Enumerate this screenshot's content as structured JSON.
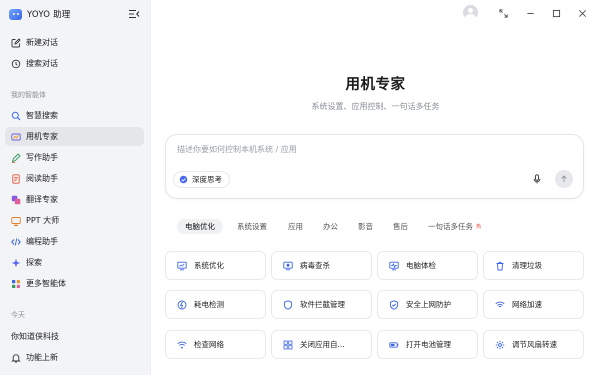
{
  "app": {
    "name": "YOYO 助理"
  },
  "sidebar": {
    "top_items": [
      {
        "label": "新建对话",
        "icon": "new-chat-icon"
      },
      {
        "label": "搜索对话",
        "icon": "history-search-icon"
      }
    ],
    "agents_section_label": "我的智能体",
    "agents": [
      {
        "label": "智慧搜索",
        "icon": "search-icon"
      },
      {
        "label": "用机专家",
        "icon": "device-expert-icon",
        "active": true
      },
      {
        "label": "写作助手",
        "icon": "pen-icon"
      },
      {
        "label": "阅读助手",
        "icon": "document-icon"
      },
      {
        "label": "翻译专家",
        "icon": "translate-icon"
      },
      {
        "label": "PPT 大师",
        "icon": "ppt-icon"
      },
      {
        "label": "编程助手",
        "icon": "code-icon"
      },
      {
        "label": "探索",
        "icon": "explore-icon"
      },
      {
        "label": "更多智能体",
        "icon": "more-icon"
      }
    ],
    "today_label": "今天",
    "history": [
      {
        "label": "你知道侠科技"
      },
      {
        "label": "功能上新",
        "icon": "bell-icon"
      }
    ]
  },
  "main": {
    "title": "用机专家",
    "subtitle": "系统设置、应用控制、一句话多任务",
    "composer": {
      "placeholder": "描述你要如何控制本机系统 / 应用",
      "value": "",
      "deep_think_label": "深度思考"
    },
    "tabs": [
      {
        "label": "电脑优化",
        "active": true
      },
      {
        "label": "系统设置"
      },
      {
        "label": "应用"
      },
      {
        "label": "办公"
      },
      {
        "label": "影音"
      },
      {
        "label": "售后"
      },
      {
        "label": "一句话多任务",
        "badge": "热"
      }
    ],
    "cards": [
      {
        "label": "系统优化",
        "icon": "monitor-optimize-icon"
      },
      {
        "label": "病毒查杀",
        "icon": "virus-scan-icon"
      },
      {
        "label": "电脑体检",
        "icon": "pc-checkup-icon"
      },
      {
        "label": "清理垃圾",
        "icon": "trash-icon"
      },
      {
        "label": "耗电检测",
        "icon": "battery-check-icon"
      },
      {
        "label": "软件拦截管理",
        "icon": "shield-icon"
      },
      {
        "label": "安全上网防护",
        "icon": "shield-check-icon"
      },
      {
        "label": "网络加速",
        "icon": "wifi-icon"
      },
      {
        "label": "检查网络",
        "icon": "wifi-check-icon"
      },
      {
        "label": "关闭应用自...",
        "icon": "apps-grid-icon"
      },
      {
        "label": "打开电池管理",
        "icon": "battery-icon"
      },
      {
        "label": "调节风扇转速",
        "icon": "gear-icon"
      }
    ]
  },
  "colors": {
    "accent": "#3b63e8",
    "sidebar_bg": "#f3f4f6",
    "hot": "#e5473c"
  }
}
